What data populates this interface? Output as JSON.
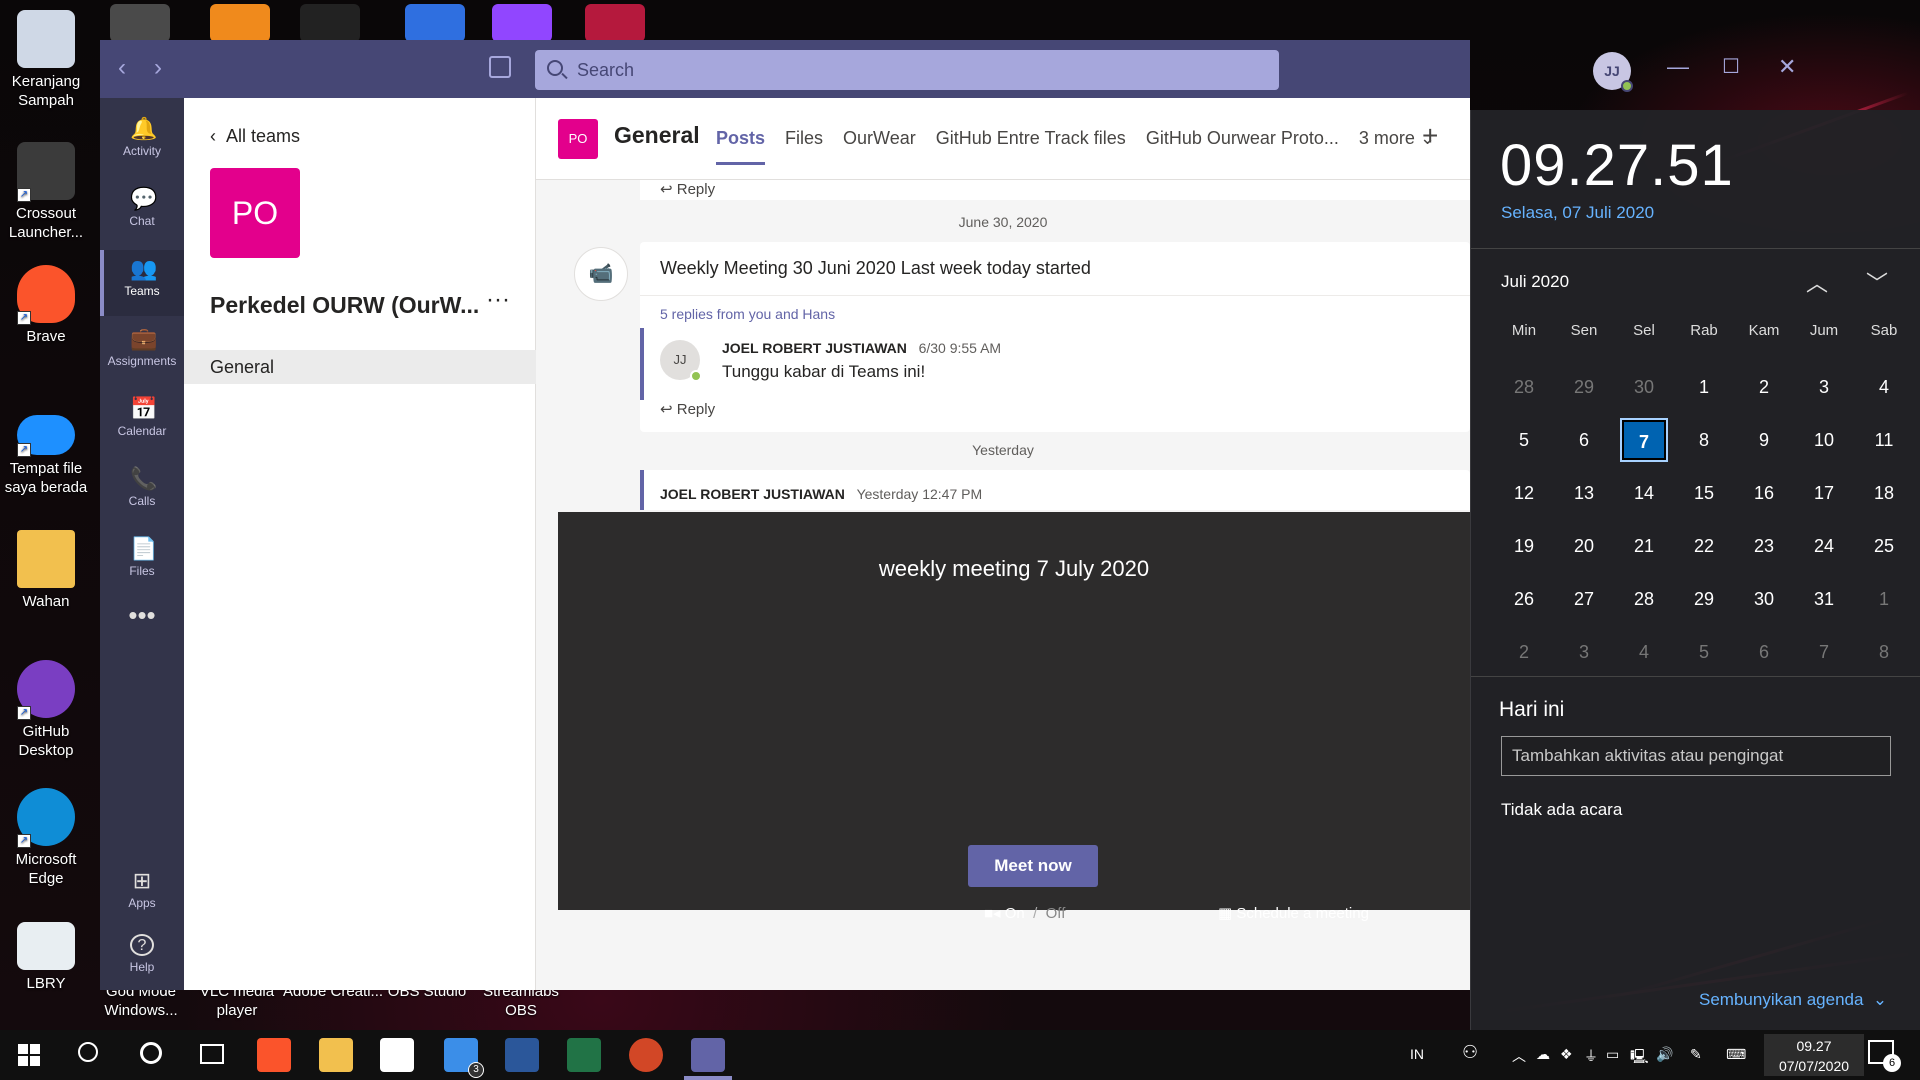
{
  "desktop": {
    "icons": [
      {
        "label": "Keranjang Sampah",
        "icon": "recycle-bin-icon",
        "color": "#cfd8e6"
      },
      {
        "label": "Crossout Launcher...",
        "icon": "crossout-icon",
        "color": "#3b3b3b"
      },
      {
        "label": "Brave",
        "icon": "brave-icon",
        "color": "#fb542b"
      },
      {
        "label": "Tempat file saya berada",
        "icon": "onedrive-icon",
        "color": "#1e90ff"
      },
      {
        "label": "Wahan",
        "icon": "folder-icon",
        "color": "#f2c04e"
      },
      {
        "label": "GitHub Desktop",
        "icon": "github-desktop-icon",
        "color": "#7a3ec2"
      },
      {
        "label": "Microsoft Edge",
        "icon": "edge-icon",
        "color": "#0f8dd6"
      },
      {
        "label": "LBRY",
        "icon": "lbry-icon",
        "color": "#e8eef2"
      }
    ],
    "bottom_labels": [
      "God Mode Windows...",
      "VLC media player",
      "Adobe Creati...",
      "OBS Studio",
      "Streamlabs OBS"
    ]
  },
  "teams": {
    "search_placeholder": "Search",
    "user_initials": "JJ",
    "rail": [
      {
        "label": "Activity",
        "glyph": "🔔"
      },
      {
        "label": "Chat",
        "glyph": "💬"
      },
      {
        "label": "Teams",
        "glyph": "👥"
      },
      {
        "label": "Assignments",
        "glyph": "💼"
      },
      {
        "label": "Calendar",
        "glyph": "📅"
      },
      {
        "label": "Calls",
        "glyph": "📞"
      },
      {
        "label": "Files",
        "glyph": "📄"
      },
      {
        "label": "Apps",
        "glyph": "⊞"
      },
      {
        "label": "Help",
        "glyph": "?"
      }
    ],
    "back_label": "All teams",
    "team_initials": "PO",
    "team_name": "Perkedel OURW (OurW...",
    "channel": "General",
    "header": {
      "badge": "PO",
      "title": "General",
      "tabs": [
        "Posts",
        "Files",
        "OurWear",
        "GitHub Entre Track files",
        "GitHub Ourwear Proto...",
        "3 more"
      ]
    },
    "feed": {
      "reply_label": "Reply",
      "date1": "June 30, 2020",
      "meeting_title": "Weekly Meeting 30 Juni 2020 Last week today started",
      "replies_info": "5 replies from you and Hans",
      "reply_author": "JOEL ROBERT JUSTIAWAN",
      "reply_time": "6/30 9:55 AM",
      "reply_text": "Tunggu kabar di Teams ini!",
      "reply_initials": "JJ",
      "date2": "Yesterday",
      "next_author": "JOEL ROBERT JUSTIAWAN",
      "next_time": "Yesterday 12:47 PM"
    },
    "meet": {
      "title": "weekly meeting 7 July 2020",
      "button": "Meet now",
      "on": "On",
      "slash": "/",
      "off": "Off",
      "schedule": "Schedule a meeting"
    }
  },
  "clock": {
    "time": "09.27.51",
    "date": "Selasa, 07 Juli 2020",
    "month": "Juli 2020",
    "weekdays": [
      "Min",
      "Sen",
      "Sel",
      "Rab",
      "Kam",
      "Jum",
      "Sab"
    ],
    "days": [
      [
        "28",
        "29",
        "30",
        "1",
        "2",
        "3",
        "4"
      ],
      [
        "5",
        "6",
        "7",
        "8",
        "9",
        "10",
        "11"
      ],
      [
        "12",
        "13",
        "14",
        "15",
        "16",
        "17",
        "18"
      ],
      [
        "19",
        "20",
        "21",
        "22",
        "23",
        "24",
        "25"
      ],
      [
        "26",
        "27",
        "28",
        "29",
        "30",
        "31",
        "1"
      ],
      [
        "2",
        "3",
        "4",
        "5",
        "6",
        "7",
        "8"
      ]
    ],
    "today": "7",
    "today_heading": "Hari ini",
    "input_placeholder": "Tambahkan aktivitas atau pengingat",
    "no_events": "Tidak ada acara",
    "hide_agenda": "Sembunyikan agenda"
  },
  "taskbar": {
    "language": "IN",
    "time": "09.27",
    "date": "07/07/2020",
    "mail_badge": "3",
    "notif_badge": "6"
  },
  "colors": {
    "teams_purple": "#464775",
    "teams_accent": "#6264a7",
    "team_pink": "#e3008c",
    "today_blue": "#0063b1"
  }
}
